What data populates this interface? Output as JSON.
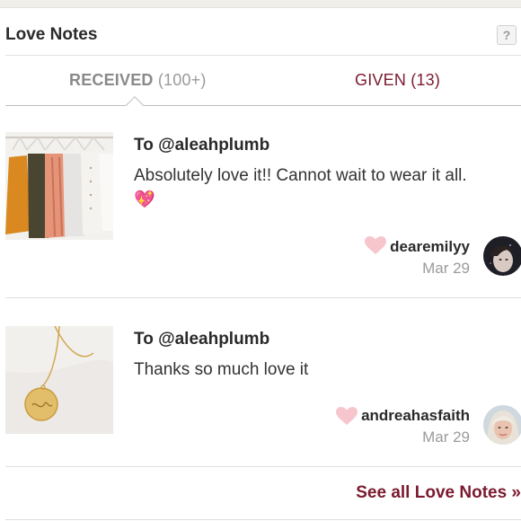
{
  "header": {
    "title": "Love Notes",
    "help_label": "?"
  },
  "tabs": {
    "received_label": "RECEIVED",
    "received_count": "(100+)",
    "given_label": "GIVEN (13)"
  },
  "notes": [
    {
      "to": "To @aleahplumb",
      "message": "Absolutely love it!! Cannot wait to wear it all.",
      "emoji": "💖",
      "sender": "dearemilyy",
      "date": "Mar 29",
      "thumbnail_icon": "clothing-rack-image",
      "avatar_icon": "user-avatar"
    },
    {
      "to": "To @aleahplumb",
      "message": "Thanks so much love it",
      "sender": "andreahasfaith",
      "date": "Mar 29",
      "thumbnail_icon": "gold-necklace-image",
      "avatar_icon": "user-avatar"
    }
  ],
  "footer": {
    "see_all_label": "See all Love Notes »"
  },
  "colors": {
    "accent": "#7b1a2e",
    "heart": "#f6c6cc",
    "muted": "#9a9a9a"
  }
}
